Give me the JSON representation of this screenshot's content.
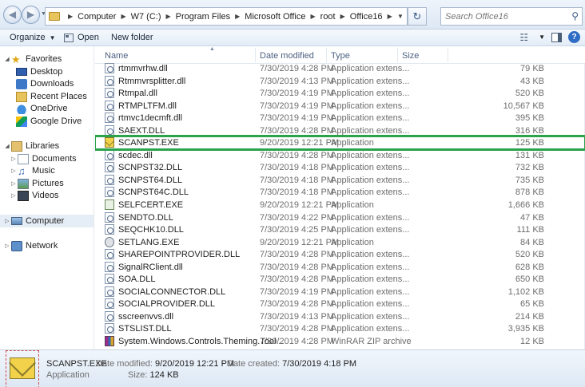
{
  "address_bar": {
    "breadcrumb": [
      "Computer",
      "W7 (C:)",
      "Program Files",
      "Microsoft Office",
      "root",
      "Office16"
    ],
    "search_placeholder": "Search Office16"
  },
  "toolbar": {
    "organize": "Organize",
    "open": "Open",
    "new_folder": "New folder"
  },
  "sidebar": {
    "favorites": {
      "label": "Favorites",
      "items": [
        "Desktop",
        "Downloads",
        "Recent Places",
        "OneDrive",
        "Google Drive"
      ]
    },
    "libraries": {
      "label": "Libraries",
      "items": [
        "Documents",
        "Music",
        "Pictures",
        "Videos"
      ]
    },
    "computer": "Computer",
    "network": "Network"
  },
  "columns": {
    "name": "Name",
    "date": "Date modified",
    "type": "Type",
    "size": "Size"
  },
  "files": [
    {
      "name": "rtmmvrhw.dll",
      "date": "7/30/2019 4:28 PM",
      "type": "Application extens...",
      "size": "79 KB",
      "icon": "dll-icon"
    },
    {
      "name": "Rtmmvrsplitter.dll",
      "date": "7/30/2019 4:13 PM",
      "type": "Application extens...",
      "size": "43 KB",
      "icon": "dll-icon"
    },
    {
      "name": "Rtmpal.dll",
      "date": "7/30/2019 4:19 PM",
      "type": "Application extens...",
      "size": "520 KB",
      "icon": "dll-icon"
    },
    {
      "name": "RTMPLTFM.dll",
      "date": "7/30/2019 4:19 PM",
      "type": "Application extens...",
      "size": "10,567 KB",
      "icon": "dll-icon"
    },
    {
      "name": "rtmvc1decmft.dll",
      "date": "7/30/2019 4:19 PM",
      "type": "Application extens...",
      "size": "395 KB",
      "icon": "dll-icon"
    },
    {
      "name": "SAEXT.DLL",
      "date": "7/30/2019 4:28 PM",
      "type": "Application extens...",
      "size": "316 KB",
      "icon": "dll-icon"
    },
    {
      "name": "SCANPST.EXE",
      "date": "9/20/2019 12:21 PM",
      "type": "Application",
      "size": "125 KB",
      "icon": "mail-icon",
      "selected": true
    },
    {
      "name": "scdec.dll",
      "date": "7/30/2019 4:28 PM",
      "type": "Application extens...",
      "size": "131 KB",
      "icon": "dll-icon"
    },
    {
      "name": "SCNPST32.DLL",
      "date": "7/30/2019 4:18 PM",
      "type": "Application extens...",
      "size": "732 KB",
      "icon": "dll-icon"
    },
    {
      "name": "SCNPST64.DLL",
      "date": "7/30/2019 4:18 PM",
      "type": "Application extens...",
      "size": "735 KB",
      "icon": "dll-icon"
    },
    {
      "name": "SCNPST64C.DLL",
      "date": "7/30/2019 4:18 PM",
      "type": "Application extens...",
      "size": "878 KB",
      "icon": "dll-icon"
    },
    {
      "name": "SELFCERT.EXE",
      "date": "9/20/2019 12:21 PM",
      "type": "Application",
      "size": "1,666 KB",
      "icon": "certificate-icon"
    },
    {
      "name": "SENDTO.DLL",
      "date": "7/30/2019 4:22 PM",
      "type": "Application extens...",
      "size": "47 KB",
      "icon": "dll-icon"
    },
    {
      "name": "SEQCHK10.DLL",
      "date": "7/30/2019 4:25 PM",
      "type": "Application extens...",
      "size": "111 KB",
      "icon": "dll-icon"
    },
    {
      "name": "SETLANG.EXE",
      "date": "9/20/2019 12:21 PM",
      "type": "Application",
      "size": "84 KB",
      "icon": "gear-icon"
    },
    {
      "name": "SHAREPOINTPROVIDER.DLL",
      "date": "7/30/2019 4:28 PM",
      "type": "Application extens...",
      "size": "520 KB",
      "icon": "dll-icon"
    },
    {
      "name": "SignalRClient.dll",
      "date": "7/30/2019 4:28 PM",
      "type": "Application extens...",
      "size": "628 KB",
      "icon": "dll-icon"
    },
    {
      "name": "SOA.DLL",
      "date": "7/30/2019 4:28 PM",
      "type": "Application extens...",
      "size": "650 KB",
      "icon": "dll-icon"
    },
    {
      "name": "SOCIALCONNECTOR.DLL",
      "date": "7/30/2019 4:19 PM",
      "type": "Application extens...",
      "size": "1,102 KB",
      "icon": "dll-icon"
    },
    {
      "name": "SOCIALPROVIDER.DLL",
      "date": "7/30/2019 4:28 PM",
      "type": "Application extens...",
      "size": "65 KB",
      "icon": "dll-icon"
    },
    {
      "name": "sscreenvvs.dll",
      "date": "7/30/2019 4:13 PM",
      "type": "Application extens...",
      "size": "214 KB",
      "icon": "dll-icon"
    },
    {
      "name": "STSLIST.DLL",
      "date": "7/30/2019 4:28 PM",
      "type": "Application extens...",
      "size": "3,935 KB",
      "icon": "dll-icon"
    },
    {
      "name": "System.Windows.Controls.Theming.Tool...",
      "date": "7/30/2019 4:28 PM",
      "type": "WinRAR ZIP archive",
      "size": "12 KB",
      "icon": "zip-icon"
    }
  ],
  "details_pane": {
    "file_name": "SCANPST.EXE",
    "file_type": "Application",
    "date_modified_label": "Date modified:",
    "date_modified": "9/20/2019 12:21 PM",
    "date_created_label": "Date created:",
    "date_created": "7/30/2019 4:18 PM",
    "size_label": "Size:",
    "size": "124 KB"
  },
  "colors": {
    "selection_outline": "#2aa34a",
    "header_text": "#4d6082",
    "secondary_text": "#6d6d6d"
  }
}
